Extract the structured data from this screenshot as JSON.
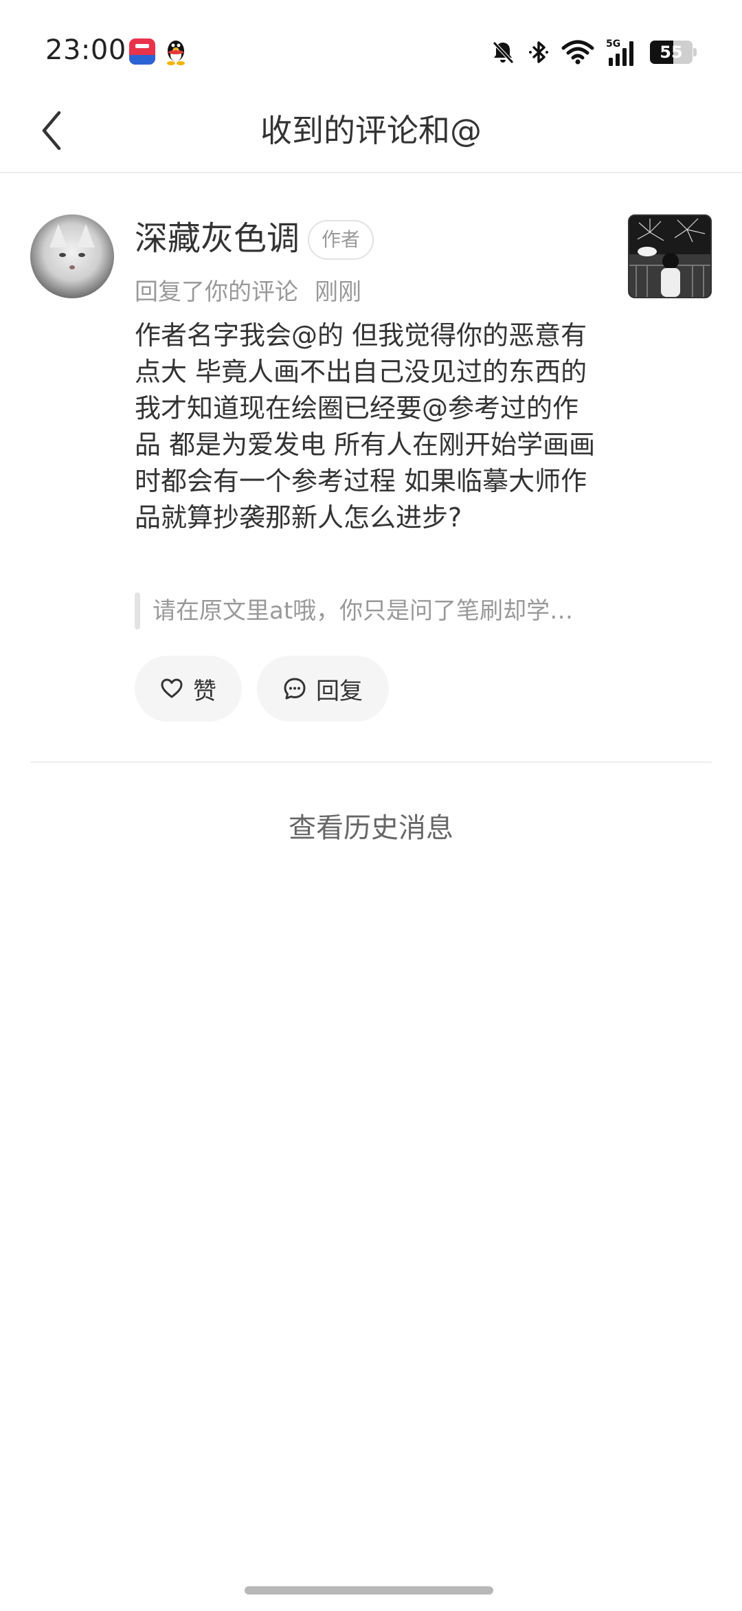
{
  "status_bar": {
    "time": "23:00",
    "battery_level": "55",
    "network": "5G",
    "notification_apps": [
      "xiaohongshu-app-icon",
      "qq-app-icon"
    ],
    "icons": [
      "mute-bell-icon",
      "bluetooth-icon",
      "wifi-icon",
      "cellular-signal-icon",
      "battery-icon"
    ]
  },
  "nav": {
    "title": "收到的评论和@",
    "back_icon": "chevron-left-icon"
  },
  "comment": {
    "username": "深藏灰色调",
    "badge": "作者",
    "action": "回复了你的评论",
    "time": "刚刚",
    "body": "作者名字我会@的 但我觉得你的恶意有点大 毕竟人画不出自己没见过的东西的 我才知道现在绘圈已经要@参考过的作品 都是为爱发电 所有人在刚开始学画画时都会有一个参考过程 如果临摹大师作品就算抄袭那新人怎么进步?",
    "quoted": "请在原文里at哦，你只是问了笔刷却学…",
    "like_label": "赞",
    "reply_label": "回复"
  },
  "history_link": "查看历史消息"
}
